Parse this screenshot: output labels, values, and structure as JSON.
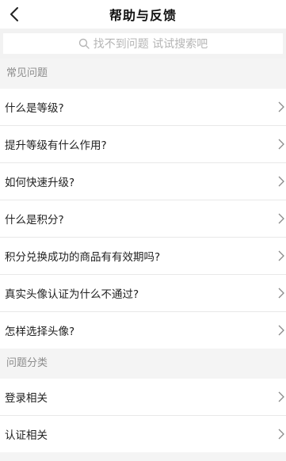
{
  "header": {
    "title": "帮助与反馈",
    "back_icon": "chevron-left-icon"
  },
  "search": {
    "placeholder": "找不到问题 试试搜索吧",
    "icon": "search-icon"
  },
  "sections": [
    {
      "title": "常见问题",
      "items": [
        "什么是等级?",
        "提升等级有什么作用?",
        "如何快速升级?",
        "什么是积分?",
        "积分兑换成功的商品有有效期吗?",
        "真实头像认证为什么不通过?",
        "怎样选择头像?"
      ]
    },
    {
      "title": "问题分类",
      "items": [
        "登录相关",
        "认证相关"
      ]
    }
  ],
  "colors": {
    "background": "#f4f4f4",
    "section_text": "#8c8c8c",
    "placeholder": "#b5b5b5"
  }
}
